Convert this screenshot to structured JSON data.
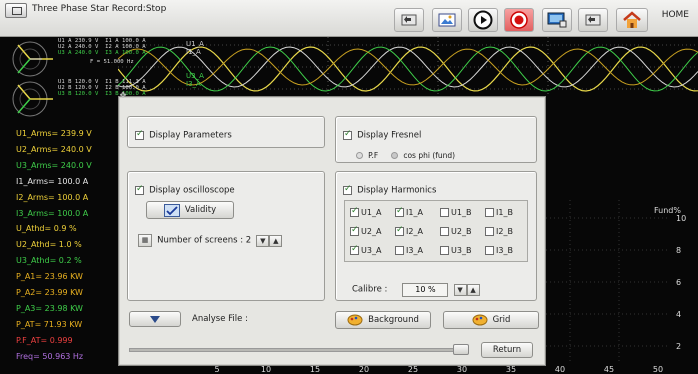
{
  "window": {
    "title": "Three Phase Star Record:Stop"
  },
  "toolbar": {
    "buttons": [
      {
        "name": "back-button",
        "icon": "back-arrow-icon"
      },
      {
        "name": "screenshot-button",
        "icon": "image-icon"
      },
      {
        "name": "play-button",
        "icon": "play-icon"
      },
      {
        "name": "record-button",
        "icon": "record-icon"
      },
      {
        "name": "monitor-button",
        "icon": "monitor-icon"
      },
      {
        "name": "return-button",
        "icon": "return-arrow-icon"
      },
      {
        "name": "home-button",
        "icon": "home-icon"
      }
    ],
    "home_label": "HOME"
  },
  "fresnel_top": {
    "rows": [
      "U1 A 230.9 V  I1 A 100.0 A",
      "U2 A 240.0 V  I2 A 100.0 A",
      "U3 A 240.0 V  I3 A 100.0 A",
      "F = 51.000 Hz"
    ]
  },
  "fresnel_bottom": {
    "rows": [
      "U1 B 120.0 V  I1 B 111.3 A",
      "U2 B 120.0 V  I2 B 100.0 A",
      "U3 B 120.0 V  I3 B 100.0 A"
    ]
  },
  "wave_labels": [
    "U1_A",
    "I1_A",
    "U3_A",
    "I3_A"
  ],
  "measurements": [
    {
      "text": "U1_Arms= 239.9 V",
      "color": "#f0d23a"
    },
    {
      "text": "U2_Arms= 240.0 V",
      "color": "#f0d23a"
    },
    {
      "text": "U3_Arms= 240.0 V",
      "color": "#3fce4a"
    },
    {
      "text": "I1_Arms= 100.0 A",
      "color": "#e8e8e8"
    },
    {
      "text": "I2_Arms= 100.0 A",
      "color": "#f0d23a"
    },
    {
      "text": "I3_Arms= 100.0 A",
      "color": "#3fce4a"
    },
    {
      "text": "U_Athd= 0.9 %",
      "color": "#f0d23a"
    },
    {
      "text": "U2_Athd= 1.0 %",
      "color": "#f0d23a"
    },
    {
      "text": "U3_Athd= 0.2 %",
      "color": "#3fce4a"
    },
    {
      "text": "P_A1= 23.96 KW",
      "color": "#e8b020"
    },
    {
      "text": "P_A2= 23.99 KW",
      "color": "#e8b020"
    },
    {
      "text": "P_A3= 23.98 KW",
      "color": "#3fce4a"
    },
    {
      "text": "P_AT= 71.93 KW",
      "color": "#e8b020"
    },
    {
      "text": "P.F_AT= 0.999",
      "color": "#ee4040"
    },
    {
      "text": "Freq= 50.963 Hz",
      "color": "#b070e0"
    }
  ],
  "harmonics_chart": {
    "y_label": "Fund%",
    "y_ticks": [
      "10",
      "8",
      "6",
      "4",
      "2"
    ],
    "x_ticks": [
      "5",
      "10",
      "15",
      "20",
      "25",
      "30",
      "35",
      "40",
      "45",
      "50"
    ]
  },
  "dialog": {
    "display_parameters": {
      "label": "Display Parameters",
      "checked": true
    },
    "display_fresnel": {
      "label": "Display Fresnel",
      "checked": true,
      "options": [
        "P.F",
        "cos phi (fund)"
      ]
    },
    "display_oscilloscope": {
      "label": "Display oscilloscope",
      "checked": true
    },
    "validity_label": "Validity",
    "screens_label": "Number of screens : 2",
    "display_harmonics": {
      "label": "Display Harmonics",
      "checked": true
    },
    "harmonics_grid": [
      [
        {
          "label": "U1_A",
          "checked": true
        },
        {
          "label": "I1_A",
          "checked": true
        },
        {
          "label": "U1_B",
          "checked": false
        },
        {
          "label": "I1_B",
          "checked": false
        }
      ],
      [
        {
          "label": "U2_A",
          "checked": true
        },
        {
          "label": "I2_A",
          "checked": true
        },
        {
          "label": "U2_B",
          "checked": false
        },
        {
          "label": "I2_B",
          "checked": false
        }
      ],
      [
        {
          "label": "U3_A",
          "checked": true
        },
        {
          "label": "I3_A",
          "checked": false
        },
        {
          "label": "U3_B",
          "checked": false
        },
        {
          "label": "I3_B",
          "checked": false
        }
      ]
    ],
    "calibre_label": "Calibre :",
    "calibre_value": "10 %",
    "analyse_label": "Analyse File :",
    "background_label": "Background",
    "grid_label": "Grid",
    "return_label": "Return"
  }
}
